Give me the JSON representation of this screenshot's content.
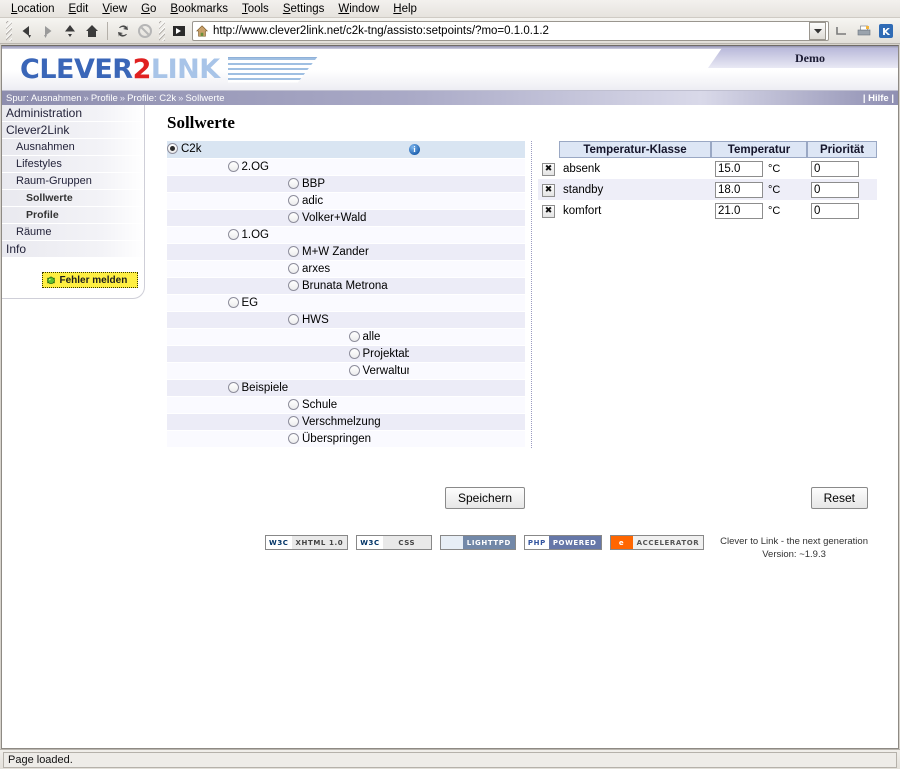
{
  "browser": {
    "menus": [
      "Location",
      "Edit",
      "View",
      "Go",
      "Bookmarks",
      "Tools",
      "Settings",
      "Window",
      "Help"
    ],
    "toolbar_icons": [
      "back-icon",
      "forward-icon",
      "up-icon",
      "home-icon",
      "reload-icon",
      "stop-icon",
      "bookmark-icon"
    ],
    "url": "http://www.clever2link.net/c2k-tng/assisto:setpoints/?mo=0.1.0.1.2",
    "status": "Page loaded."
  },
  "header": {
    "logo_part1": "CLEVER",
    "logo_part2": "2",
    "logo_part3": "LINK",
    "demo_tab": "Demo",
    "breadcrumb_prefix": "Spur:",
    "breadcrumb": [
      "Ausnahmen",
      "Profile",
      "Profile: C2k",
      "Sollwerte"
    ],
    "breadcrumb_separator": "»",
    "help_link": "| Hilfe |"
  },
  "sidebar": {
    "items": [
      {
        "label": "Administration",
        "level": 0
      },
      {
        "label": "Clever2Link",
        "level": 0
      },
      {
        "label": "Ausnahmen",
        "level": 1
      },
      {
        "label": "Lifestyles",
        "level": 1
      },
      {
        "label": "Raum-Gruppen",
        "level": 1
      },
      {
        "label": "Sollwerte",
        "level": 2
      },
      {
        "label": "Profile",
        "level": 2
      },
      {
        "label": "Räume",
        "level": 1
      },
      {
        "label": "Info",
        "level": 0
      }
    ],
    "bug_button": "Fehler melden"
  },
  "main": {
    "title": "Sollwerte",
    "tree": [
      {
        "label": "C2k",
        "indent": 0,
        "selected": true,
        "info": "i"
      },
      {
        "label": "2.OG",
        "indent": 1,
        "selected": false,
        "info": ""
      },
      {
        "label": "BBP",
        "indent": 2,
        "selected": false,
        "info": ""
      },
      {
        "label": "adic",
        "indent": 2,
        "selected": false,
        "info": ""
      },
      {
        "label": "Volker+Wald",
        "indent": 2,
        "selected": false,
        "info": ""
      },
      {
        "label": "1.OG",
        "indent": 1,
        "selected": false,
        "info": ""
      },
      {
        "label": "M+W Zander",
        "indent": 2,
        "selected": false,
        "info": ""
      },
      {
        "label": "arxes",
        "indent": 2,
        "selected": false,
        "info": ""
      },
      {
        "label": "Brunata Metrona",
        "indent": 2,
        "selected": false,
        "info": ""
      },
      {
        "label": "EG",
        "indent": 1,
        "selected": false,
        "info": ""
      },
      {
        "label": "HWS",
        "indent": 2,
        "selected": false,
        "info": ""
      },
      {
        "label": "alle",
        "indent": 3,
        "selected": false,
        "info": ""
      },
      {
        "label": "Projektabteilung",
        "indent": 3,
        "selected": false,
        "info": ""
      },
      {
        "label": "Verwaltung",
        "indent": 3,
        "selected": false,
        "info": ""
      },
      {
        "label": "Beispiele",
        "indent": 1,
        "selected": false,
        "info": ""
      },
      {
        "label": "Schule",
        "indent": 2,
        "selected": false,
        "info": ""
      },
      {
        "label": "Verschmelzung",
        "indent": 2,
        "selected": false,
        "info": ""
      },
      {
        "label": "Überspringen",
        "indent": 2,
        "selected": false,
        "info": ""
      }
    ],
    "temp_table": {
      "headers": [
        "Temperatur-Klasse",
        "Temperatur",
        "Priorität"
      ],
      "unit": "°C",
      "delete_label": "✖",
      "rows": [
        {
          "name": "absenk",
          "temperature": "15.0",
          "priority": "0"
        },
        {
          "name": "standby",
          "temperature": "18.0",
          "priority": "0"
        },
        {
          "name": "komfort",
          "temperature": "21.0",
          "priority": "0"
        }
      ]
    },
    "save_button": "Speichern",
    "reset_button": "Reset"
  },
  "footer": {
    "badges": [
      {
        "left": "W3C",
        "right": "XHTML 1.0",
        "kind": "w3c"
      },
      {
        "left": "W3C",
        "right": "CSS",
        "kind": "w3c"
      },
      {
        "left": "",
        "right": "LIGHTTPD",
        "kind": "lighttpd"
      },
      {
        "left": "PHP",
        "right": "POWERED",
        "kind": "php"
      },
      {
        "left": "e",
        "right": "ACCELERATOR",
        "kind": "acc"
      }
    ],
    "tagline": "Clever to Link - the next generation",
    "version": "Version: ~1.9.3"
  }
}
